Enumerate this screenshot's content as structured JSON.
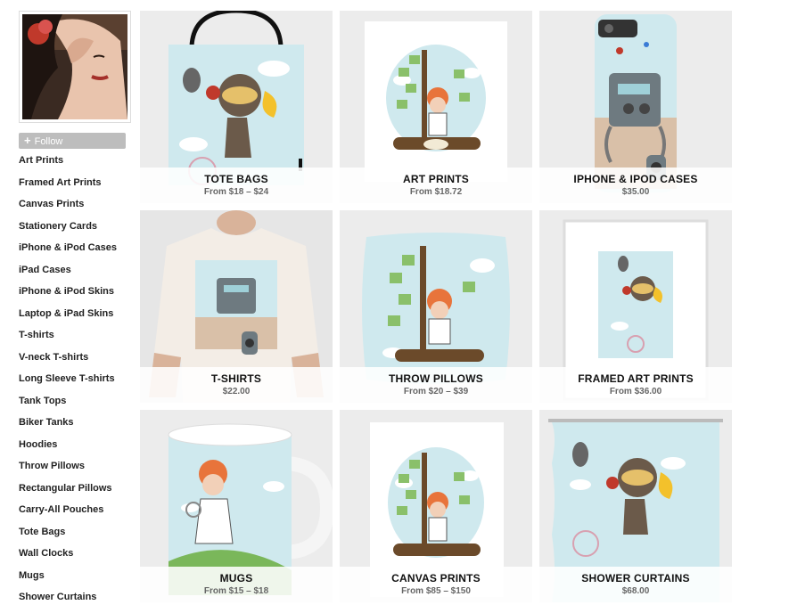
{
  "artist": {
    "avatar_icon": "artist-avatar-photo",
    "follow_label": "Follow",
    "follow_icon": "plus-icon"
  },
  "categories": [
    {
      "label": "Art Prints"
    },
    {
      "label": "Framed Art Prints"
    },
    {
      "label": "Canvas Prints"
    },
    {
      "label": "Stationery Cards"
    },
    {
      "label": "iPhone & iPod Cases"
    },
    {
      "label": "iPad Cases"
    },
    {
      "label": "iPhone & iPod Skins"
    },
    {
      "label": "Laptop & iPad Skins"
    },
    {
      "label": "T-shirts"
    },
    {
      "label": "V-neck T-shirts"
    },
    {
      "label": "Long Sleeve T-shirts"
    },
    {
      "label": "Tank Tops"
    },
    {
      "label": "Biker Tanks"
    },
    {
      "label": "Hoodies"
    },
    {
      "label": "Throw Pillows"
    },
    {
      "label": "Rectangular Pillows"
    },
    {
      "label": "Carry-All Pouches"
    },
    {
      "label": "Tote Bags"
    },
    {
      "label": "Wall Clocks"
    },
    {
      "label": "Mugs"
    },
    {
      "label": "Shower Curtains"
    }
  ],
  "products": [
    {
      "name": "TOTE BAGS",
      "price": "From $18 – $24",
      "image": "tote-bag-aviator-girl-image"
    },
    {
      "name": "ART PRINTS",
      "price": "From $18.72",
      "image": "art-print-tree-girl-image"
    },
    {
      "name": "IPHONE & IPOD CASES",
      "price": "$35.00",
      "image": "iphone-case-robot-image"
    },
    {
      "name": "T-SHIRTS",
      "price": "$22.00",
      "image": "tshirt-robot-image"
    },
    {
      "name": "THROW PILLOWS",
      "price": "From $20 – $39",
      "image": "throw-pillow-tree-girl-image"
    },
    {
      "name": "FRAMED ART PRINTS",
      "price": "From $36.00",
      "image": "framed-print-aviator-image"
    },
    {
      "name": "MUGS",
      "price": "From $15 – $18",
      "image": "mug-girl-image"
    },
    {
      "name": "CANVAS PRINTS",
      "price": "From $85 – $150",
      "image": "canvas-print-tree-girl-image"
    },
    {
      "name": "SHOWER CURTAINS",
      "price": "$68.00",
      "image": "shower-curtain-aviator-image"
    }
  ],
  "colors": {
    "sky": "#cfe9ee",
    "follow_bg": "#bdbdbd",
    "tile_bg": "#ececec"
  }
}
